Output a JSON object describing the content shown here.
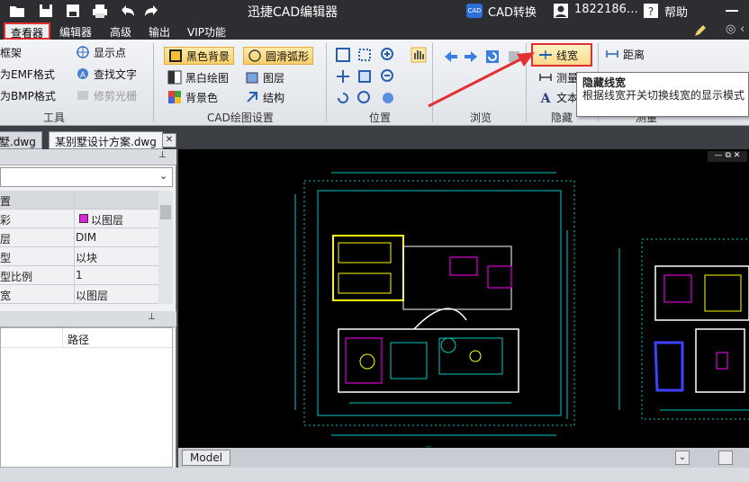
{
  "titlebar": {
    "title": "迅捷CAD编辑器",
    "cad_convert": "CAD转换",
    "phone": "1822186…",
    "help": "帮助",
    "cad_badge": "CAD"
  },
  "menubar": {
    "items": [
      "查看器",
      "编辑器",
      "高级",
      "输出",
      "VIP功能"
    ]
  },
  "ribbon": {
    "tools": {
      "label": "工具",
      "items": [
        "框架",
        "为EMF格式",
        "为BMP格式"
      ],
      "items2": [
        "显示点",
        "查找文字",
        "修剪光栅"
      ]
    },
    "cad_settings": {
      "label": "CAD绘图设置",
      "items": [
        "黑色背景",
        "黑白绘图",
        "背景色"
      ],
      "items2": [
        "圆滑弧形",
        "图层",
        "结构"
      ]
    },
    "position": {
      "label": "位置"
    },
    "browse": {
      "label": "浏览"
    },
    "hide": {
      "label": "隐藏",
      "items": [
        "线宽",
        "测量",
        "文本"
      ]
    },
    "measure": {
      "label": "测量",
      "items": [
        "距离"
      ]
    }
  },
  "tooltip": {
    "title": "隐藏线宽",
    "body": "根据线宽开关切换线宽的显示模式"
  },
  "tabs": [
    "墅.dwg",
    "某别墅设计方案.dwg"
  ],
  "properties": {
    "rows": [
      {
        "k": "置",
        "v": ""
      },
      {
        "k": "彩",
        "v": "以图层"
      },
      {
        "k": "层",
        "v": "DIM"
      },
      {
        "k": "型",
        "v": "以块"
      },
      {
        "k": "型比例",
        "v": "1"
      },
      {
        "k": "宽",
        "v": "以图层"
      }
    ],
    "color_swatch": "#e020e0"
  },
  "lower_pane": {
    "col_path": "路径"
  },
  "canvas": {
    "tab_model": "Model"
  },
  "colors": {
    "accent_red": "#e03030",
    "cad_cyan": "#00c8c8",
    "cad_yellow": "#ffff00",
    "cad_magenta": "#ff00ff"
  }
}
